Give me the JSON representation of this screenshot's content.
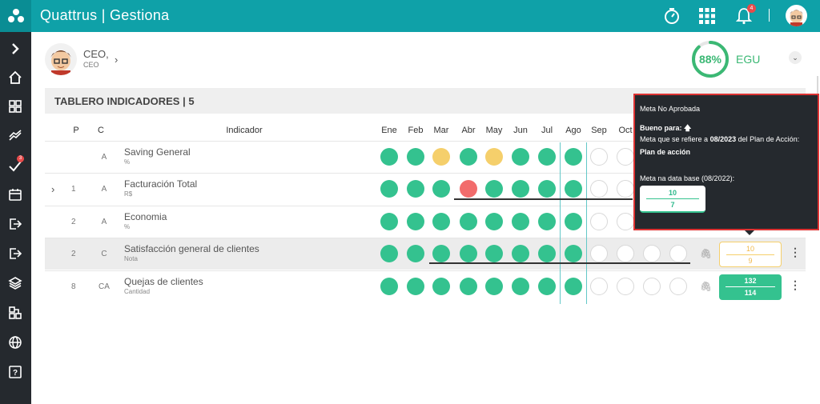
{
  "app": {
    "title": "Quattrus | Gestiona",
    "notification_count": "4"
  },
  "sidebar": {
    "tasks_badge": "3"
  },
  "profile": {
    "name": "CEO,",
    "role": "CEO"
  },
  "egu": {
    "value": "88%",
    "label": "EGU",
    "percent": 88
  },
  "panel": {
    "title": "TABLERO INDICADORES | 5"
  },
  "columns": {
    "p": "P",
    "c": "C",
    "indicator": "Indicador",
    "months": [
      "Ene",
      "Feb",
      "Mar",
      "Abr",
      "May",
      "Jun",
      "Jul",
      "Ago",
      "Sep",
      "Oct"
    ]
  },
  "rows": [
    {
      "p": "",
      "c": "A",
      "name": "Saving General",
      "unit": "%"
    },
    {
      "p": "1",
      "c": "A",
      "name": "Facturación Total",
      "unit": "R$"
    },
    {
      "p": "2",
      "c": "A",
      "name": "Economia",
      "unit": "%"
    },
    {
      "p": "2",
      "c": "C",
      "name": "Satisfacción general de clientes",
      "unit": "Nota",
      "goal": [
        "10",
        "9"
      ]
    },
    {
      "p": "8",
      "c": "CA",
      "name": "Quejas de clientes",
      "unit": "Cantidad",
      "goal": [
        "132",
        "114"
      ]
    }
  ],
  "tooltip": {
    "title": "Meta No Aprobada",
    "good_for_label": "Bueno para:",
    "good_for_arrow": "🡅",
    "meta_text_prefix": "Meta que se refiere a",
    "meta_period": "08/2023",
    "meta_text_suffix": "del Plan de Acción:",
    "plan_label": "Plan de acción",
    "base_label": "Meta na data base (08/2022):",
    "base_values": [
      "10",
      "7"
    ]
  },
  "colors": {
    "green": "#34c28f",
    "yellow": "#f5cf6b",
    "red": "#f26c6c",
    "teal": "#0fa1a8"
  }
}
